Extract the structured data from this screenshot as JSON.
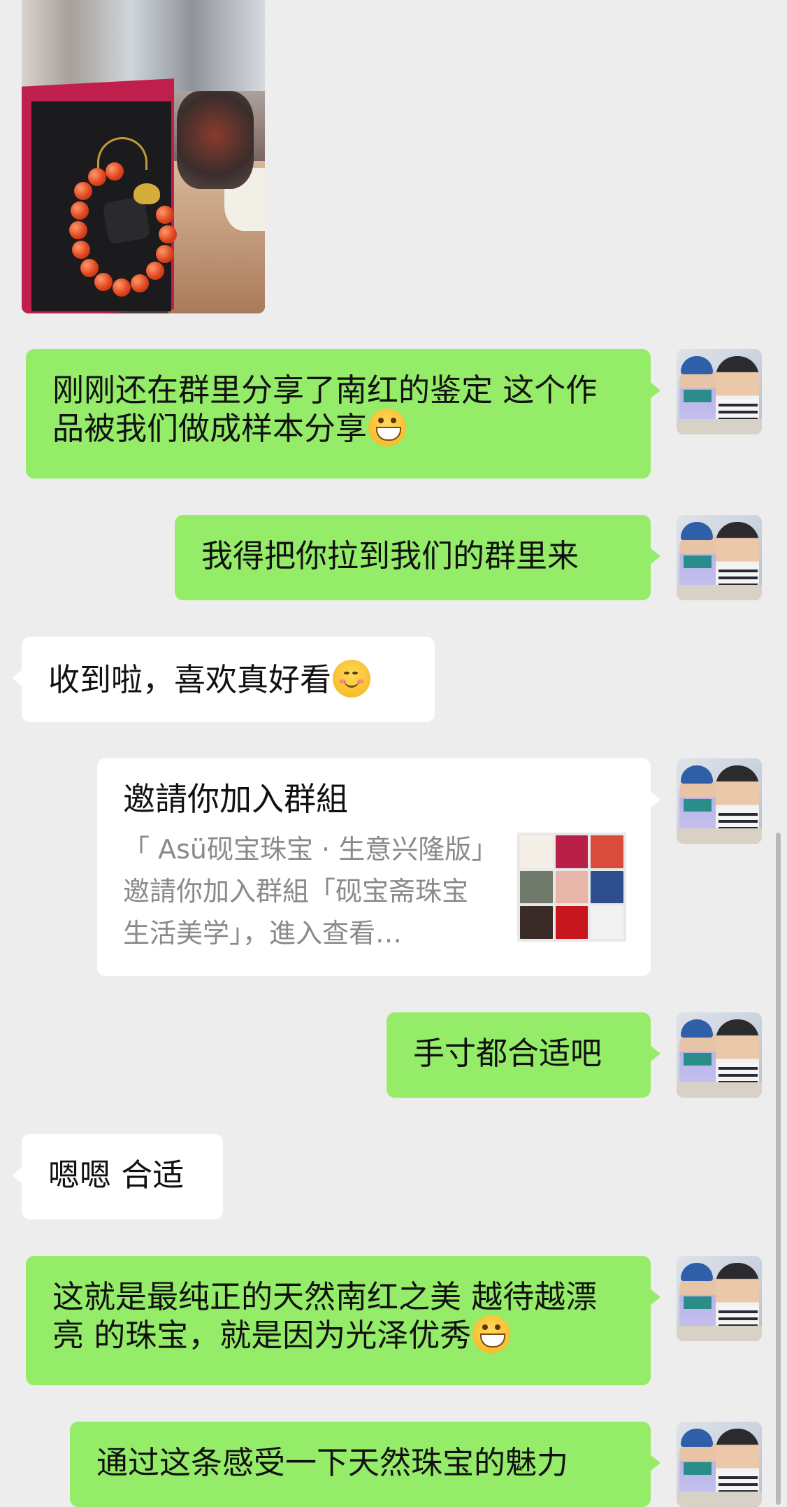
{
  "messages": {
    "m1": "刚刚还在群里分享了南红的鉴定 这个作品被我们做成样本分享",
    "m2": "我得把你拉到我们的群里来",
    "m3": "收到啦，喜欢真好看",
    "m5": "手寸都合适吧",
    "m6": "嗯嗯 合适",
    "m7": "这就是最纯正的天然南红之美 越待越漂亮 的珠宝，就是因为光泽优秀",
    "m8": "通过这条感受一下天然珠宝的魅力"
  },
  "invite": {
    "title": "邀請你加入群組",
    "desc": "「 Asü砚宝珠宝 · 生意兴隆版」邀請你加入群組「砚宝斋珠宝生活美学」，進入查看…"
  },
  "icons": {
    "emoji_grin": "grinning-face-icon",
    "emoji_smile": "smiling-face-icon",
    "avatar": "user-avatar"
  },
  "colors": {
    "background": "#ededed",
    "sent_bubble": "#95ec69",
    "received_bubble": "#ffffff",
    "secondary_text": "#8a8a8a"
  }
}
